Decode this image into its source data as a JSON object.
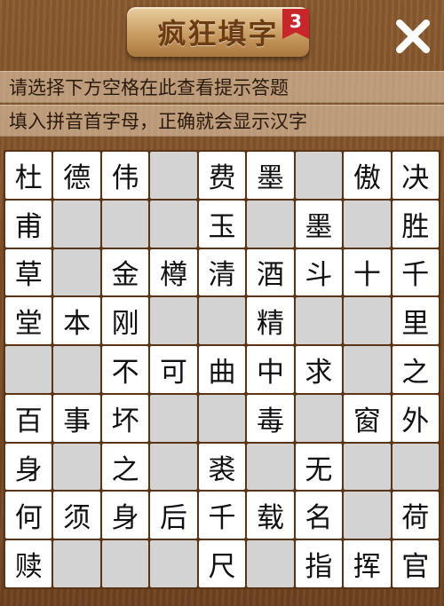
{
  "header": {
    "title": "疯狂填字",
    "level": "3",
    "close_icon": "close-x-icon"
  },
  "hints": {
    "line1": "请选择下方空格在此查看提示答题",
    "line2": "填入拼音首字母，正确就会显示汉字"
  },
  "colors": {
    "wood": "#7a4a23",
    "cell_filled": "#ffffff",
    "cell_blank": "#d3d3d3",
    "ribbon": "#c8262a"
  },
  "grid": [
    [
      "杜",
      "德",
      "伟",
      "",
      "费",
      "墨",
      "",
      "傲",
      "决"
    ],
    [
      "甫",
      "",
      "",
      "",
      "玉",
      "",
      "墨",
      "",
      "胜"
    ],
    [
      "草",
      "",
      "金",
      "樽",
      "清",
      "酒",
      "斗",
      "十",
      "千"
    ],
    [
      "堂",
      "本",
      "刚",
      "",
      "",
      "精",
      "",
      "",
      "里"
    ],
    [
      "",
      "",
      "不",
      "可",
      "曲",
      "中",
      "求",
      "",
      "之"
    ],
    [
      "百",
      "事",
      "坏",
      "",
      "",
      "毒",
      "",
      "窗",
      "外"
    ],
    [
      "身",
      "",
      "之",
      "",
      "裘",
      "",
      "无",
      "",
      ""
    ],
    [
      "何",
      "须",
      "身",
      "后",
      "千",
      "载",
      "名",
      "",
      "荷"
    ],
    [
      "赎",
      "",
      "",
      "",
      "尺",
      "",
      "指",
      "挥",
      "官"
    ]
  ]
}
